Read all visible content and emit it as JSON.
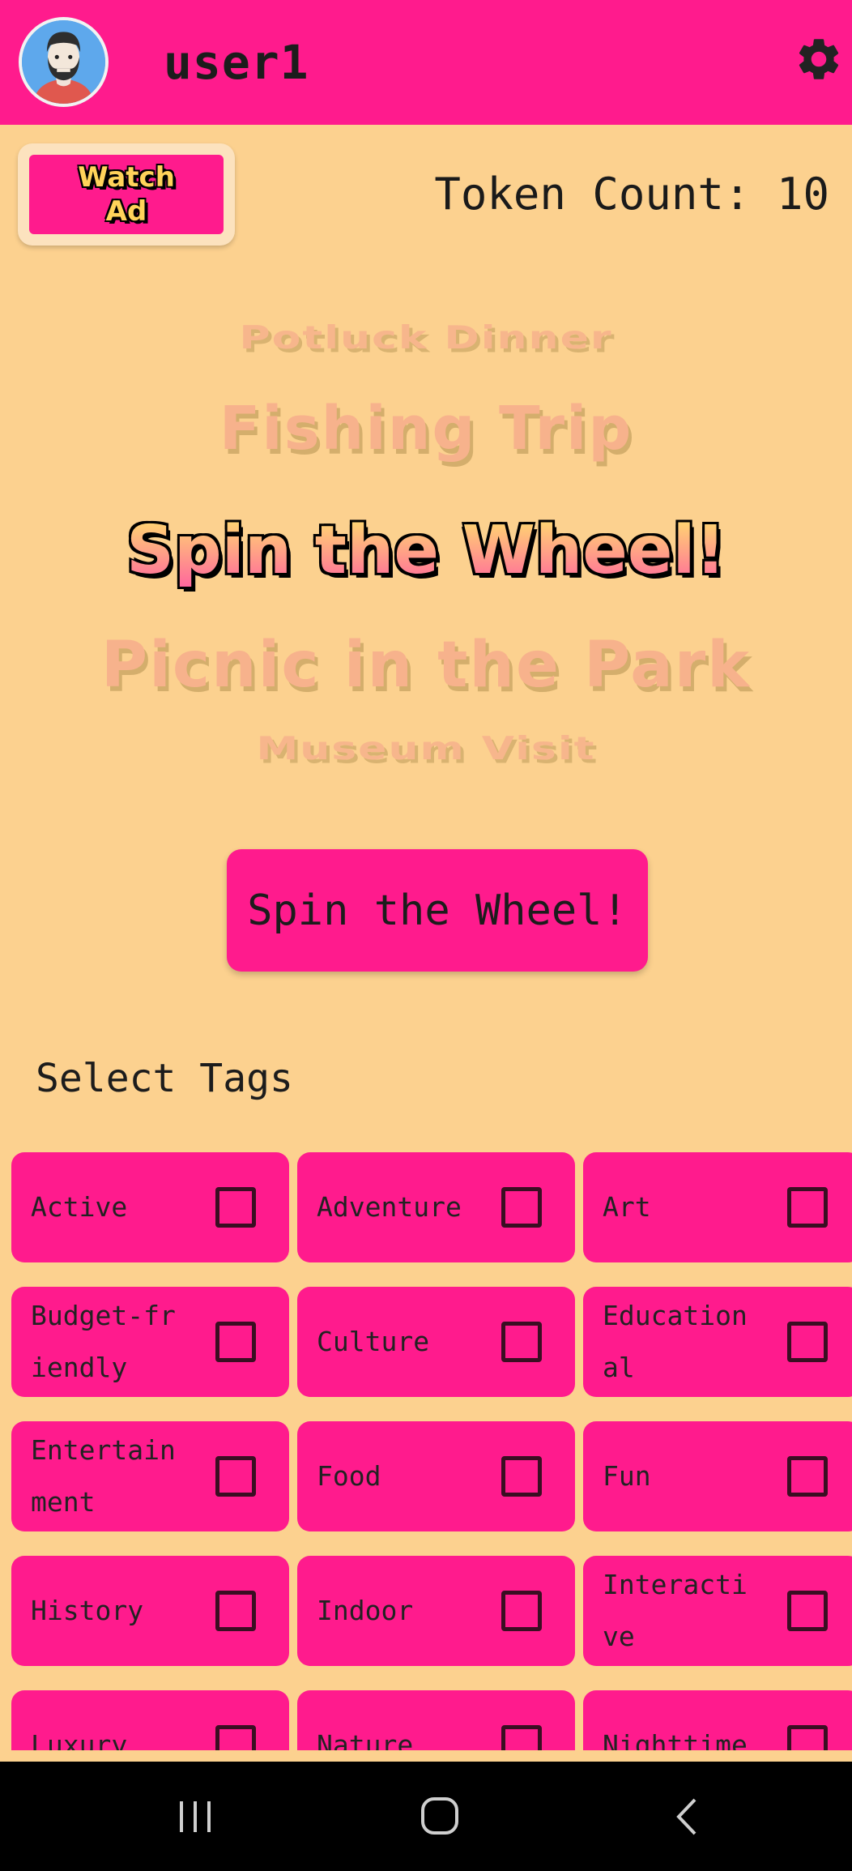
{
  "header": {
    "username": "user1",
    "avatar_icon": "avatar-icon",
    "settings_icon": "gear-icon",
    "colors": {
      "primary": "#FF1B8D",
      "background": "#FCD18F"
    }
  },
  "watch_ad": {
    "label": "Watch Ad"
  },
  "token": {
    "label": "Token Count: 10"
  },
  "wheel": {
    "items": [
      "Potluck Dinner",
      "Fishing Trip",
      "Spin the Wheel!",
      "Picnic in the Park",
      "Museum Visit"
    ]
  },
  "spin_button": {
    "label": "Spin the Wheel!"
  },
  "tags": {
    "title": "Select Tags",
    "items": [
      {
        "label": "Active",
        "checked": false
      },
      {
        "label": "Adventure",
        "checked": false
      },
      {
        "label": "Art",
        "checked": false
      },
      {
        "label": "Budget-friendly",
        "checked": false
      },
      {
        "label": "Culture",
        "checked": false
      },
      {
        "label": "Educational",
        "checked": false
      },
      {
        "label": "Entertainment",
        "checked": false
      },
      {
        "label": "Food",
        "checked": false
      },
      {
        "label": "Fun",
        "checked": false
      },
      {
        "label": "History",
        "checked": false
      },
      {
        "label": "Indoor",
        "checked": false
      },
      {
        "label": "Interactive",
        "checked": false
      },
      {
        "label": "Luxury",
        "checked": false
      },
      {
        "label": "Nature",
        "checked": false
      },
      {
        "label": "Nighttime",
        "checked": false
      }
    ]
  },
  "system_nav": {
    "icons": [
      "recent-apps-icon",
      "home-icon",
      "back-icon"
    ]
  }
}
